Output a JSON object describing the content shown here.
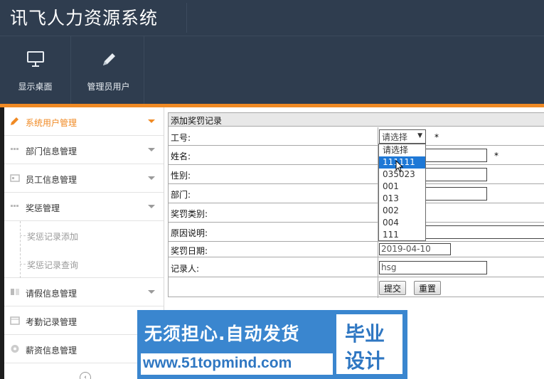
{
  "app": {
    "title": "讯飞人力资源系统"
  },
  "toolbar": [
    {
      "label": "显示桌面",
      "icon": "monitor-icon"
    },
    {
      "label": "管理员用户",
      "icon": "pencil-icon"
    }
  ],
  "colors": {
    "header_bg": "#2f3d4f",
    "accent": "#f08a24",
    "highlight": "#1e78d6",
    "watermark": "#3a86cf"
  },
  "sidebar": {
    "items": [
      {
        "label": "系统用户管理",
        "icon": "pencil-icon",
        "active": true
      },
      {
        "label": "部门信息管理",
        "icon": "grid-icon"
      },
      {
        "label": "员工信息管理",
        "icon": "id-card-icon"
      },
      {
        "label": "奖惩管理",
        "icon": "grid-icon"
      },
      {
        "label": "请假信息管理",
        "icon": "columns-icon"
      },
      {
        "label": "考勤记录管理",
        "icon": "calendar-icon"
      },
      {
        "label": "薪资信息管理",
        "icon": "settings-icon"
      }
    ],
    "sub_items": [
      "奖惩记录添加",
      "奖惩记录查询"
    ]
  },
  "form": {
    "title": "添加奖罚记录",
    "labels": {
      "emp_no": "工号:",
      "name": "姓名:",
      "gender": "性别:",
      "dept": "部门:",
      "category": "奖罚类别:",
      "reason": "原因说明:",
      "date": "奖罚日期:",
      "recorder": "记录人:"
    },
    "emp_no_selected": "请选择",
    "required_mark": "*",
    "date_value": "2019-04-10",
    "recorder_value": "hsg",
    "submit_label": "提交",
    "reset_label": "重置"
  },
  "dropdown": {
    "options": [
      "请选择",
      "111111",
      "035023",
      "001",
      "013",
      "002",
      "004",
      "111"
    ],
    "highlighted_index": 1
  },
  "watermark": {
    "main": "无须担心.自动发货",
    "url": "www.51topmind.com",
    "right_top": "毕业",
    "right_bottom": "设计"
  }
}
